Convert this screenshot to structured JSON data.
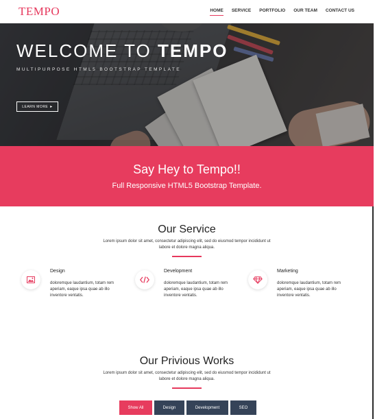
{
  "brand": {
    "logo": "TEMPO",
    "accent": "#e6385c",
    "dark": "#354358"
  },
  "nav": {
    "items": [
      "HOME",
      "SERVICE",
      "PORTFOLIO",
      "OUR TEAM",
      "CONTACT US"
    ],
    "active": "HOME"
  },
  "hero": {
    "title_light": "WELCOME TO ",
    "title_bold": "TEMPO",
    "subtitle": "MULTIPURPOSE HTML5 BOOTSTRAP TEMPLATE",
    "button_label": "LEARN MORE",
    "button_icon": "arrow-right-icon"
  },
  "callout": {
    "title": "Say Hey to Tempo!!",
    "subtitle": "Full Responsive HTML5 Bootstrap Template."
  },
  "services": {
    "title": "Our Service",
    "description": "Lorem ipsum dolor sit amet, consectetur adipiscing elit, sed do eiusmod tempor incididunt ut labore et dolore magna aliqua.",
    "items": [
      {
        "icon": "image-icon",
        "name": "Design",
        "text": "doloremque laudantium, totam rem aperiam, eaque ipsa quae ab illo inventore ventatis."
      },
      {
        "icon": "code-icon",
        "name": "Development",
        "text": "doloremque laudantium, totam rem aperiam, eaque ipsa quae ab illo inventore ventatis."
      },
      {
        "icon": "diamond-icon",
        "name": "Marketing",
        "text": "doloremque laudantium, totam rem aperiam, eaque ipsa quae ab illo inventore ventatis."
      }
    ]
  },
  "works": {
    "title": "Our Privious Works",
    "description": "Lorem ipsum dolor sit amet, consectetur adipiscing elit, sed do eiusmod tempor incididunt ut labore et dolore magna aliqua.",
    "filters": [
      "Show All",
      "Design",
      "Development",
      "SEO"
    ],
    "active_filter": "Show All"
  }
}
